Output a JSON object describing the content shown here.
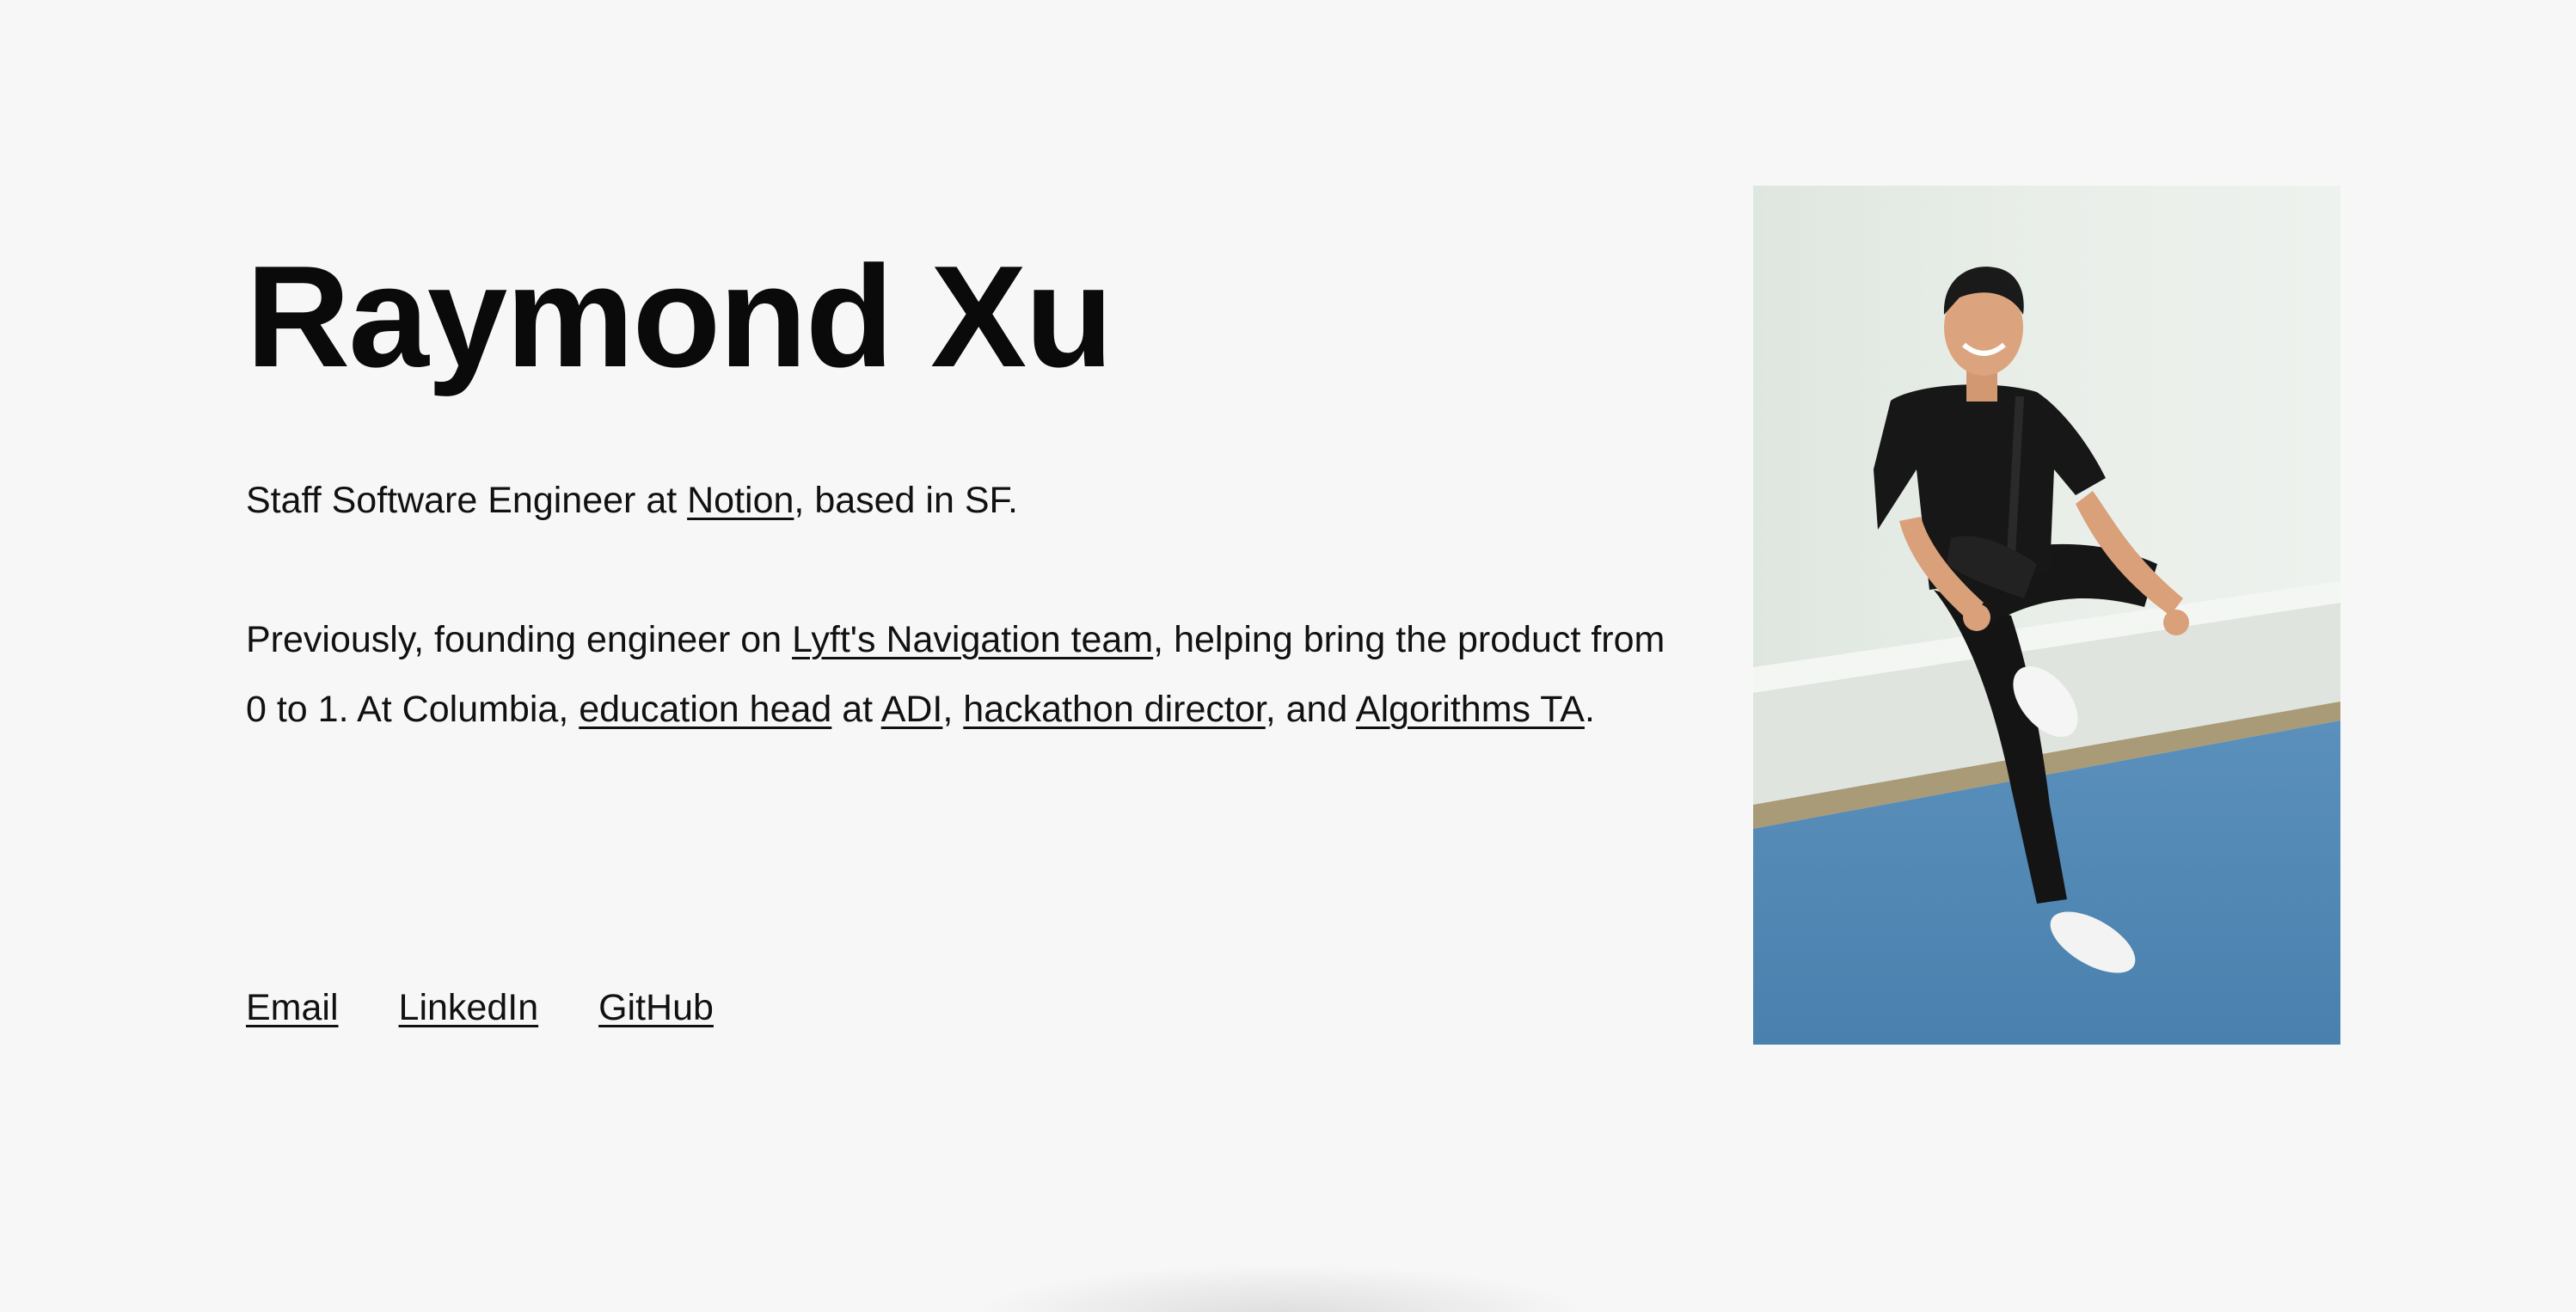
{
  "profile": {
    "name": "Raymond Xu"
  },
  "intro": {
    "part1": "Staff Software Engineer at ",
    "notion_link": "Notion",
    "part2": ", based in SF."
  },
  "background": {
    "part1": "Previously, founding engineer on ",
    "lyft_link": "Lyft's Navigation team",
    "part2": ", helping bring the product from 0 to 1. At Columbia, ",
    "education_link": "education head",
    "part3": " at ",
    "adi_link": "ADI",
    "part4": ", ",
    "hackathon_link": "hackathon director",
    "part5": ", and ",
    "algorithms_link": "Algorithms TA",
    "part6": "."
  },
  "links": {
    "email": "Email",
    "linkedin": "LinkedIn",
    "github": "GitHub"
  },
  "colors": {
    "background": "#f7f7f7",
    "text": "#111111",
    "wall": "#e6ece6",
    "floor": "#4f87b3"
  }
}
